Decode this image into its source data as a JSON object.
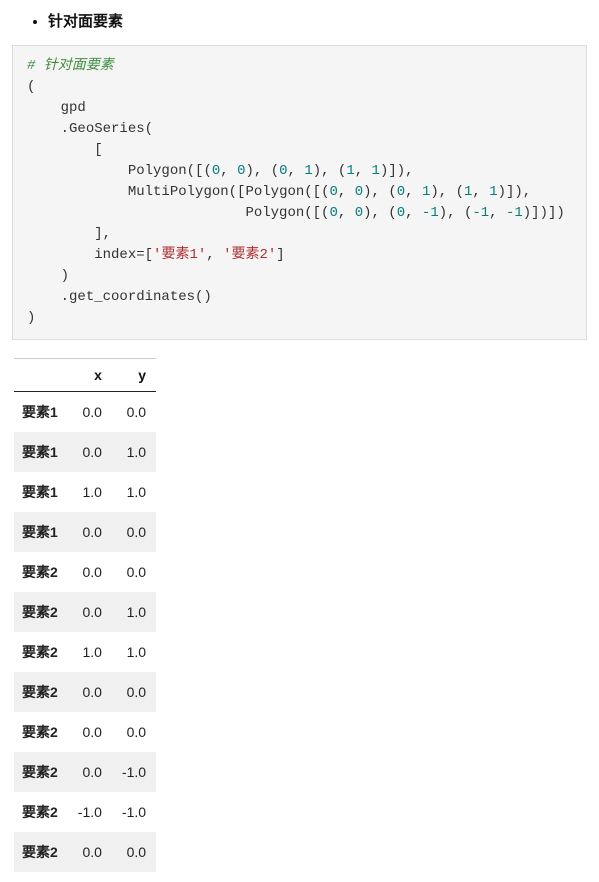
{
  "bullet_heading": "针对面要素",
  "code": {
    "comment": "# 针对面要素",
    "gpd": "gpd",
    "geoSeries": ".GeoSeries(",
    "polygon": "Polygon",
    "multipolygon": "MultiPolygon",
    "nums": {
      "zero": "0",
      "one": "1",
      "neg1": "-1"
    },
    "index_label": "index",
    "index_vals": [
      "'要素1'",
      "'要素2'"
    ],
    "get_coords": ".get_coordinates()"
  },
  "table": {
    "headers": {
      "idx": "",
      "x": "x",
      "y": "y"
    },
    "rows": [
      {
        "idx": "要素1",
        "x": "0.0",
        "y": "0.0"
      },
      {
        "idx": "要素1",
        "x": "0.0",
        "y": "1.0"
      },
      {
        "idx": "要素1",
        "x": "1.0",
        "y": "1.0"
      },
      {
        "idx": "要素1",
        "x": "0.0",
        "y": "0.0"
      },
      {
        "idx": "要素2",
        "x": "0.0",
        "y": "0.0"
      },
      {
        "idx": "要素2",
        "x": "0.0",
        "y": "1.0"
      },
      {
        "idx": "要素2",
        "x": "1.0",
        "y": "1.0"
      },
      {
        "idx": "要素2",
        "x": "0.0",
        "y": "0.0"
      },
      {
        "idx": "要素2",
        "x": "0.0",
        "y": "0.0"
      },
      {
        "idx": "要素2",
        "x": "0.0",
        "y": "-1.0"
      },
      {
        "idx": "要素2",
        "x": "-1.0",
        "y": "-1.0"
      },
      {
        "idx": "要素2",
        "x": "0.0",
        "y": "0.0"
      }
    ]
  }
}
